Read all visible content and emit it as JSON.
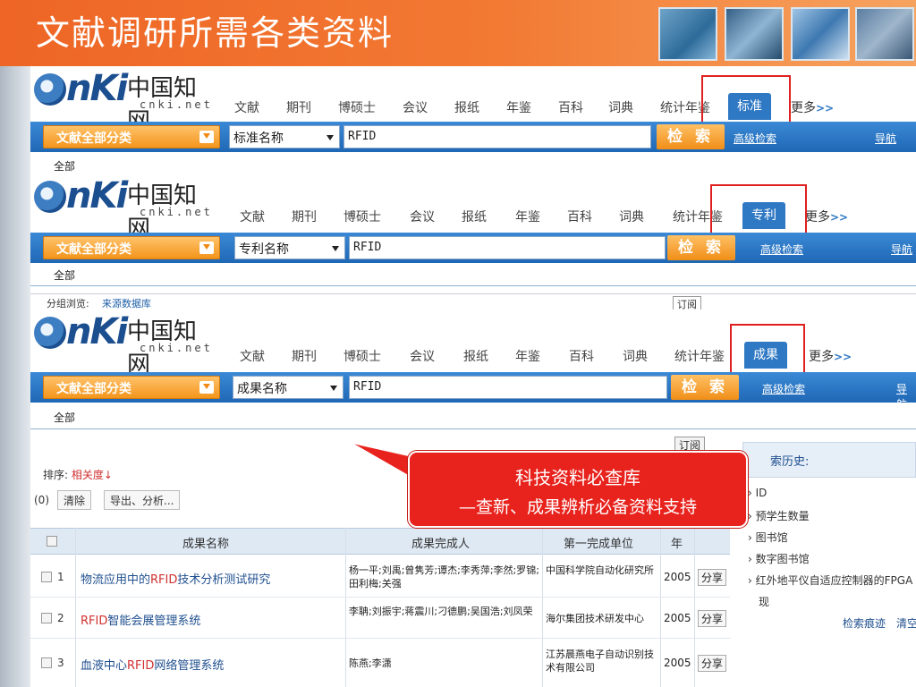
{
  "slide": {
    "title": "文献调研所需各类资料"
  },
  "logo": {
    "cn": "中国知网",
    "net": "cnki.net"
  },
  "nav_items": [
    "文献",
    "期刊",
    "博硕士",
    "会议",
    "报纸",
    "年鉴",
    "百科",
    "词典",
    "统计年鉴"
  ],
  "panels": [
    {
      "active_tab": "标准",
      "field": "标准名称",
      "query": "RFID"
    },
    {
      "active_tab": "专利",
      "field": "专利名称",
      "query": "RFID"
    },
    {
      "active_tab": "成果",
      "field": "成果名称",
      "query": "RFID"
    }
  ],
  "common": {
    "more": "更多",
    "more_arrows": ">>",
    "category": "文献全部分类",
    "search_btn": "检 索",
    "advanced": "高级检索",
    "guide": "导航",
    "all": "全部",
    "browse_label": "分组浏览:",
    "browse_value": "来源数据库",
    "subscribe": "订阅"
  },
  "results": {
    "sort_label": "排序:",
    "sort_value": "相关度↓",
    "count": "(0)",
    "clear": "清除",
    "export": "导出、分析...",
    "headers": {
      "name": "成果名称",
      "people": "成果完成人",
      "org": "第一完成单位",
      "year": "年"
    },
    "rows": [
      {
        "num": "1",
        "pre": "物流应用中的",
        "hl": "RFID",
        "post": "技术分析测试研究",
        "people": "杨一平;刘禹;曾隽芳;谭杰;李秀萍;李然;罗锦;田利梅;关强",
        "org": "中国科学院自动化研究所",
        "year": "2005",
        "share": "分享"
      },
      {
        "num": "2",
        "pre": "",
        "hl": "RFID",
        "post": "智能会展管理系统",
        "people": "李聃;刘振宇;蒋震川;刁德鹏;吴国浩;刘凤荣",
        "org": "海尔集团技术研发中心",
        "year": "2005",
        "share": "分享"
      },
      {
        "num": "3",
        "pre": "血液中心",
        "hl": "RFID",
        "post": "网络管理系统",
        "people": "陈燕;李潇",
        "org": "江苏晨燕电子自动识别技术有限公司",
        "year": "2005",
        "share": "分享"
      }
    ]
  },
  "history": {
    "title": "索历史:",
    "items": [
      "ID",
      "预学生数量",
      "图书馆",
      "数字图书馆",
      "红外地平仪自适应控制器的FPGA",
      "现"
    ],
    "foot_left": "检索痕迹",
    "foot_right": "清空"
  },
  "callout": {
    "line1": "科技资料必查库",
    "line2": "—查新、成果辨析必备资料支持"
  }
}
